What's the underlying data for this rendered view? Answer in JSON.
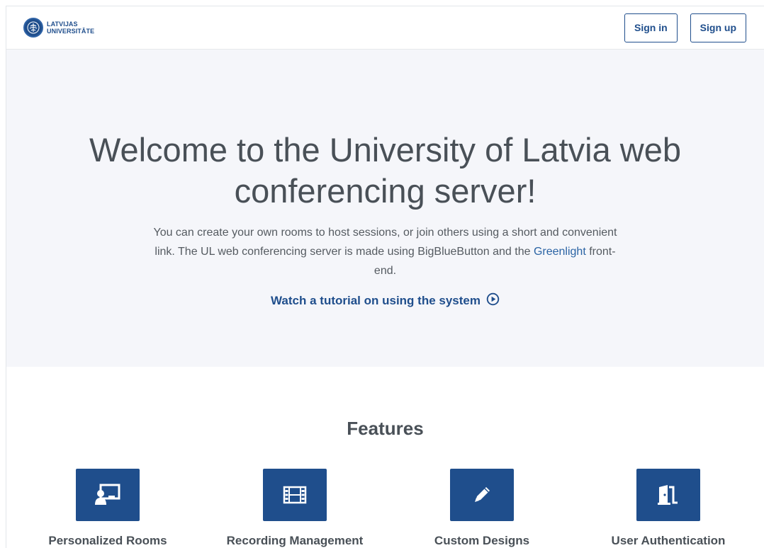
{
  "header": {
    "brand_line1": "LATVIJAS",
    "brand_line2": "UNIVERSITĀTE",
    "sign_in": "Sign in",
    "sign_up": "Sign up"
  },
  "hero": {
    "title": "Welcome to the University of Latvia web conferencing server!",
    "desc_part1": "You can create your own rooms to host sessions, or join others using a short and convenient link. The UL web conferencing server is made using BigBlueButton and the ",
    "desc_link": "Greenlight",
    "desc_part2": " front-end.",
    "tutorial": "Watch a tutorial on using the system"
  },
  "features": {
    "title": "Features",
    "items": [
      {
        "label": "Personalized Rooms",
        "icon": "personalized-rooms-icon"
      },
      {
        "label": "Recording Management",
        "icon": "film-icon"
      },
      {
        "label": "Custom Designs",
        "icon": "pencil-icon"
      },
      {
        "label": "User Authentication",
        "icon": "door-open-icon"
      }
    ]
  },
  "colors": {
    "accent": "#1f4e8c",
    "hero_bg": "#f5f6fa",
    "text": "#495057"
  }
}
